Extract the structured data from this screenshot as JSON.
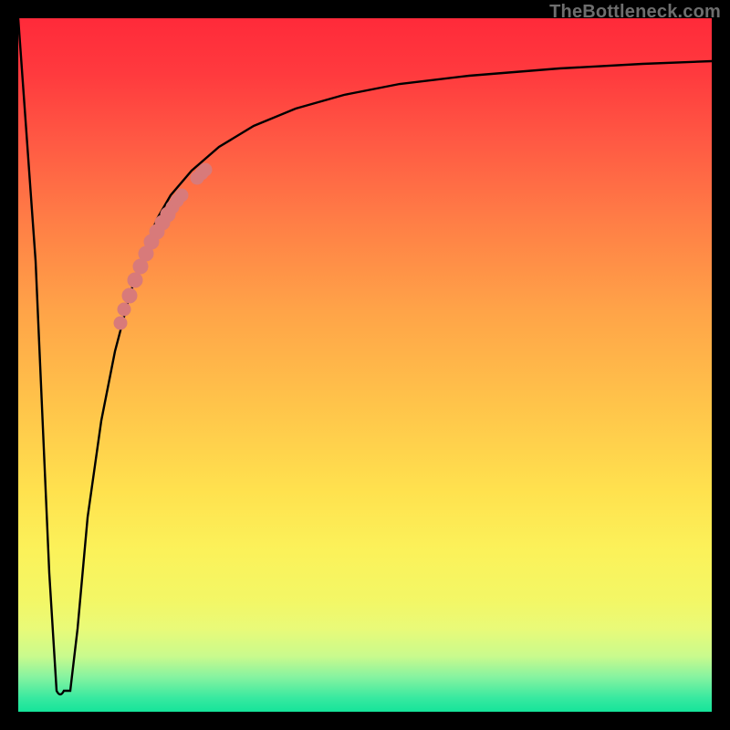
{
  "watermark": {
    "text": "TheBottleneck.com"
  },
  "chart_data": {
    "type": "line",
    "title": "",
    "xlabel": "",
    "ylabel": "",
    "xlim": [
      0,
      100
    ],
    "ylim": [
      0,
      100
    ],
    "background": "vertical-rainbow-gradient red→green",
    "series": [
      {
        "name": "bottleneck-curve",
        "x": [
          0,
          2.5,
          4.5,
          5.5,
          6.5,
          7.5,
          8.5,
          10,
          12,
          14,
          16,
          18,
          20,
          22,
          25,
          29,
          34,
          40,
          47,
          55,
          65,
          78,
          90,
          100
        ],
        "y": [
          100,
          65,
          20,
          3,
          2,
          3,
          12,
          28,
          42,
          52,
          60,
          66,
          71,
          74.5,
          78,
          81.5,
          84.5,
          87,
          89,
          90.5,
          91.7,
          92.7,
          93.4,
          93.8
        ]
      }
    ],
    "highlight": {
      "name": "user-range-marker",
      "color_hex": "#d87a7a",
      "x": [
        14.7,
        15.3,
        16.0,
        16.8,
        17.6,
        18.4,
        19.2,
        20.0,
        20.8,
        21.6,
        22.3,
        22.9,
        23.5,
        25.8,
        26.4,
        27.0
      ],
      "y": [
        56.0,
        58.0,
        60.0,
        62.2,
        64.2,
        66.0,
        67.7,
        69.2,
        70.5,
        71.7,
        72.8,
        73.7,
        74.5,
        77.0,
        77.6,
        78.2
      ]
    },
    "minimum": {
      "x": 6.0,
      "y": 2
    }
  }
}
